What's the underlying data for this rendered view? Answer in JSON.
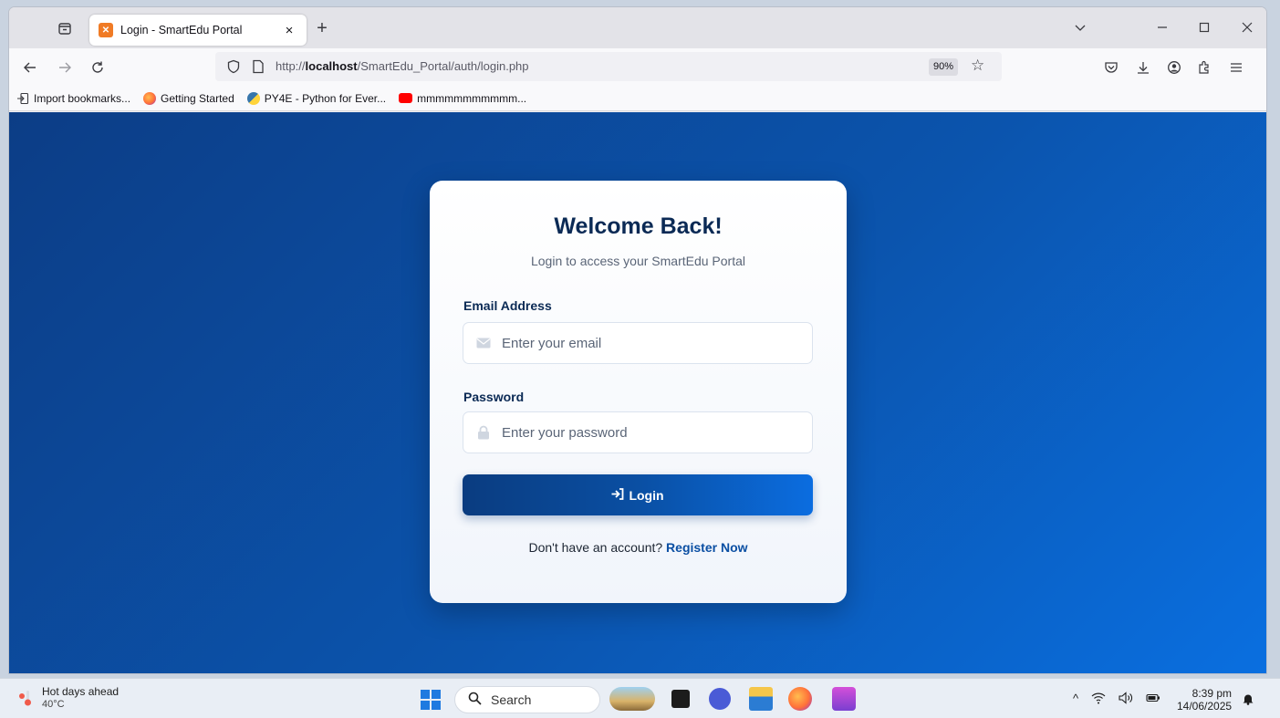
{
  "browser": {
    "tab_title": "Login - SmartEdu Portal",
    "tab_close": "×",
    "new_tab": "+",
    "url_prefix": "http://",
    "url_host": "localhost",
    "url_path": "/SmartEdu_Portal/auth/login.php",
    "zoom": "90%",
    "bookmarks": [
      {
        "label": "Import bookmarks...",
        "icon": "import-icon"
      },
      {
        "label": "Getting Started",
        "icon": "firefox-icon"
      },
      {
        "label": "PY4E - Python for Ever...",
        "icon": "python-icon"
      },
      {
        "label": "mmmmmmmmmmm...",
        "icon": "youtube-icon"
      }
    ]
  },
  "login": {
    "title": "Welcome Back!",
    "subtitle": "Login to access your SmartEdu Portal",
    "email_label": "Email Address",
    "email_placeholder": "Enter your email",
    "email_value": "",
    "password_label": "Password",
    "password_placeholder": "Enter your password",
    "password_value": "",
    "button_label": "Login",
    "register_prompt": "Don't have an account?",
    "register_link": "Register Now"
  },
  "taskbar": {
    "weather_title": "Hot days ahead",
    "weather_temp": "40°C",
    "search_label": "Search",
    "time": "8:39 pm",
    "date": "14/06/2025"
  },
  "colors": {
    "page_bg_start": "#0c3d86",
    "page_bg_end": "#0a6fe0",
    "title_color": "#0b2a55",
    "link_color": "#0b4fa3"
  }
}
